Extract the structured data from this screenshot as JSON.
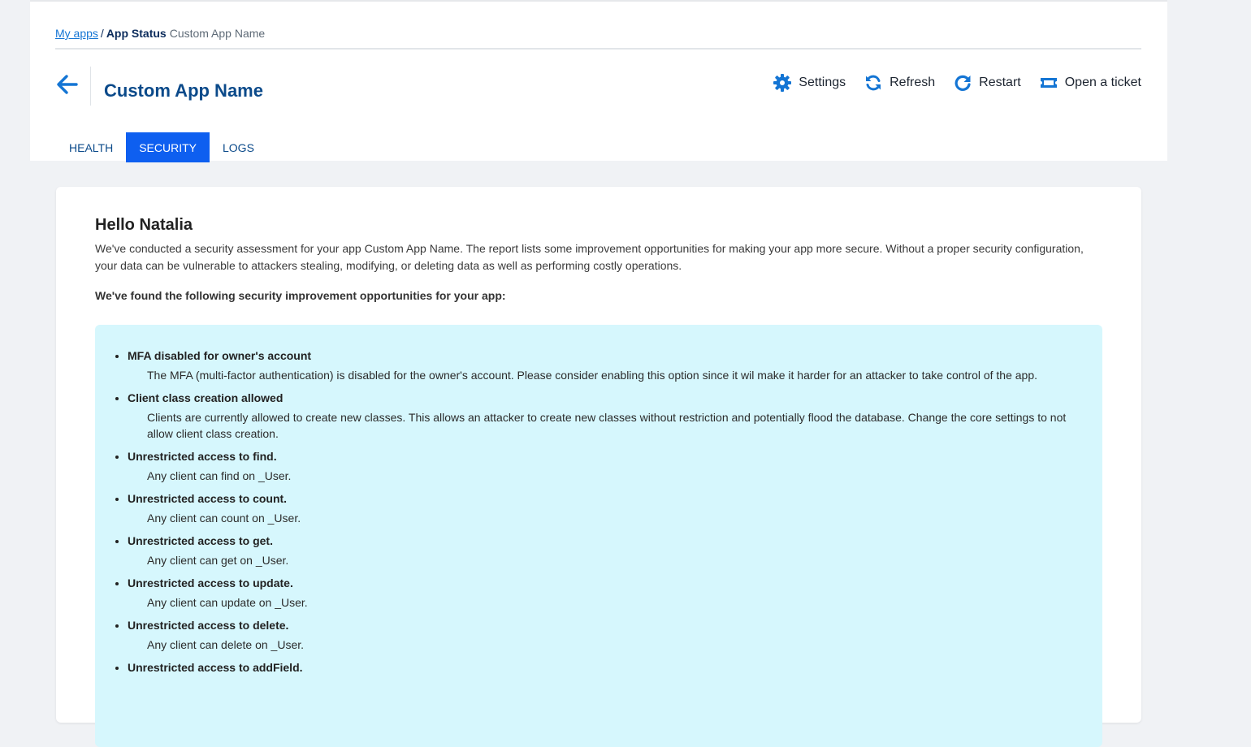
{
  "breadcrumb": {
    "my_apps": "My apps",
    "separator": "/",
    "current_section": "App Status",
    "app_name": "Custom App Name"
  },
  "header": {
    "title": "Custom App Name",
    "actions": {
      "settings": "Settings",
      "refresh": "Refresh",
      "restart": "Restart",
      "ticket": "Open a ticket"
    }
  },
  "tabs": [
    {
      "label": "HEALTH",
      "active": false
    },
    {
      "label": "SECURITY",
      "active": true
    },
    {
      "label": "LOGS",
      "active": false
    }
  ],
  "report": {
    "greeting": "Hello Natalia",
    "intro": "We've conducted a security assessment for your app Custom App Name. The report lists some improvement opportunities for making your app more secure. Without a proper security configuration, your data can be vulnerable to attackers stealing, modifying, or deleting data as well as performing costly operations.",
    "found_heading": "We've found the following security improvement opportunities for your app:",
    "issues": [
      {
        "title": "MFA disabled for owner's account",
        "description": "The MFA (multi-factor authentication) is disabled for the owner's account. Please consider enabling this option since it wil make it harder for an attacker to take control of the app."
      },
      {
        "title": "Client class creation allowed",
        "description": "Clients are currently allowed to create new classes. This allows an attacker to create new classes without restriction and potentially flood the database. Change the core settings to not allow client class creation."
      },
      {
        "title": "Unrestricted access to find.",
        "description": "Any client can find on _User."
      },
      {
        "title": "Unrestricted access to count.",
        "description": "Any client can count on _User."
      },
      {
        "title": "Unrestricted access to get.",
        "description": "Any client can get on _User."
      },
      {
        "title": "Unrestricted access to update.",
        "description": "Any client can update on _User."
      },
      {
        "title": "Unrestricted access to delete.",
        "description": "Any client can delete on _User."
      },
      {
        "title": "Unrestricted access to addField.",
        "description": ""
      }
    ]
  },
  "colors": {
    "accent": "#0e5ff0",
    "link": "#1475d4",
    "title": "#0b4a8a",
    "icon": "#1475d4",
    "issues_background": "#d6f7fd",
    "page_background": "#f0f2f5"
  }
}
